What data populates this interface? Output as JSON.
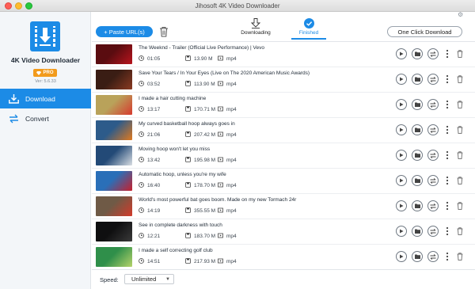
{
  "window": {
    "title": "Jihosoft 4K Video Downloader"
  },
  "sidebar": {
    "app_name": "4K Video Downloader",
    "badge": "PRO",
    "version": "Ver: 5.6.33",
    "nav": [
      {
        "label": "Download",
        "icon": "download-icon",
        "active": true
      },
      {
        "label": "Convert",
        "icon": "convert-icon",
        "active": false
      }
    ]
  },
  "toolbar": {
    "paste_label": "+ Paste URL(s)",
    "tabs": [
      {
        "label": "Downloading",
        "icon": "download-arrow-icon"
      },
      {
        "label": "Finished",
        "icon": "check-circle-icon",
        "active": true
      }
    ],
    "one_click_label": "One Click Download"
  },
  "colors": {
    "accent": "#1c8be6",
    "pro_badge": "#f29b1d"
  },
  "items": [
    {
      "title": "The Weeknd - Trailer (Official Live Performance) | Vevo",
      "duration": "01:05",
      "size": "13.90 M",
      "format": "mp4",
      "thumb_colors": [
        "#5a0c10",
        "#b8141d"
      ],
      "thumb_text": ""
    },
    {
      "title": "Save Your Tears / In Your Eyes (Live on The 2020 American Music Awards)",
      "duration": "03:52",
      "size": "113.90 M",
      "format": "mp4",
      "thumb_colors": [
        "#3a1d14",
        "#8b3a22"
      ],
      "thumb_text": ""
    },
    {
      "title": "I made a hair cutting machine",
      "duration": "13:17",
      "size": "170.71 M",
      "format": "mp4",
      "thumb_colors": [
        "#b9a25a",
        "#d63a2e"
      ],
      "thumb_text": ""
    },
    {
      "title": "My curved basketball hoop always goes in",
      "duration": "21:06",
      "size": "207.42 M",
      "format": "mp4",
      "thumb_colors": [
        "#2d5b8a",
        "#e0791e"
      ],
      "thumb_text": ""
    },
    {
      "title": "Moving hoop won't let you miss",
      "duration": "13:42",
      "size": "195.98 M",
      "format": "mp4",
      "thumb_colors": [
        "#234a77",
        "#d9dee3"
      ],
      "thumb_text": ""
    },
    {
      "title": "Automatic hoop, unless you're my wife",
      "duration": "16:40",
      "size": "178.70 M",
      "format": "mp4",
      "thumb_colors": [
        "#2a6fb8",
        "#c7202c"
      ],
      "thumb_text": ""
    },
    {
      "title": "World's most powerful bat goes boom. Made on my new Tormach 24r",
      "duration": "14:19",
      "size": "355.55 M",
      "format": "mp4",
      "thumb_colors": [
        "#6f5a46",
        "#d23a2a"
      ],
      "thumb_text": ""
    },
    {
      "title": "See in complete darkness with touch",
      "duration": "12:21",
      "size": "183.70 M",
      "format": "mp4",
      "thumb_colors": [
        "#0f0f10",
        "#3a3a3a"
      ],
      "thumb_text": ""
    },
    {
      "title": "I made a self correcting golf club",
      "duration": "14:51",
      "size": "217.93 M",
      "format": "mp4",
      "thumb_colors": [
        "#2f8f4a",
        "#b5d36a"
      ],
      "thumb_text": ""
    }
  ],
  "footer": {
    "speed_label": "Speed:",
    "speed_value": "Unlimited"
  }
}
